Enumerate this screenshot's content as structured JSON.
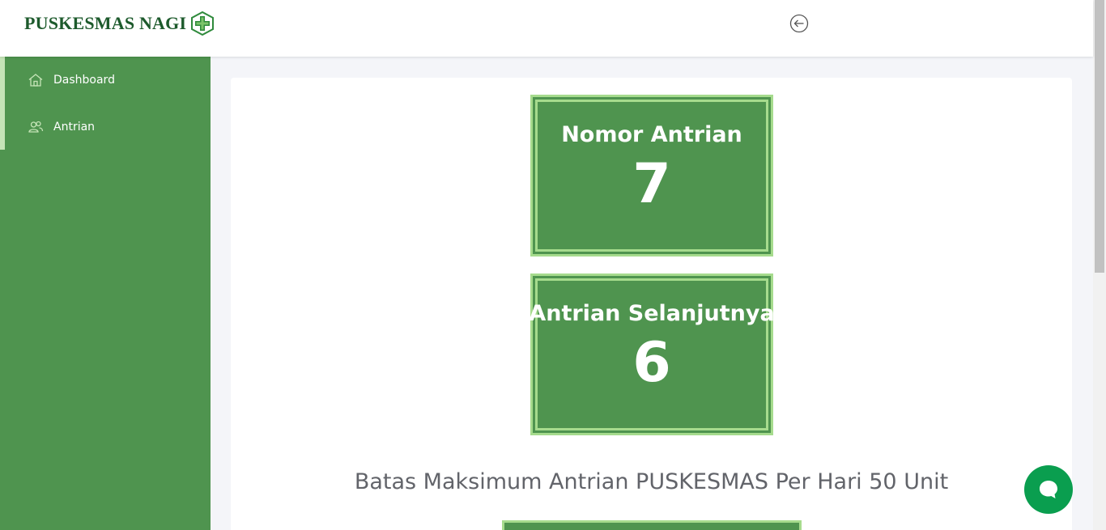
{
  "header": {
    "brand": "PUSKESMAS NAGI",
    "logo_icon": "medical-cross-icon",
    "back_icon": "arrow-left-circle-icon"
  },
  "sidebar": {
    "items": [
      {
        "label": "Dashboard",
        "icon": "home-icon"
      },
      {
        "label": "Antrian",
        "icon": "users-icon"
      }
    ]
  },
  "queue": {
    "current": {
      "title": "Nomor Antrian",
      "number": "7"
    },
    "next": {
      "title": "Antrian Selanjutnya",
      "number": "6"
    },
    "limit_text": "Batas Maksimum Antrian PUSKESMAS Per Hari 50 Unit"
  },
  "chat": {
    "icon": "chat-bubble-icon"
  },
  "colors": {
    "primary_green": "#4f944f",
    "light_green": "#a6db8d",
    "brand_dark_green": "#1d5a2c",
    "chat_green": "#0a9e4f"
  }
}
